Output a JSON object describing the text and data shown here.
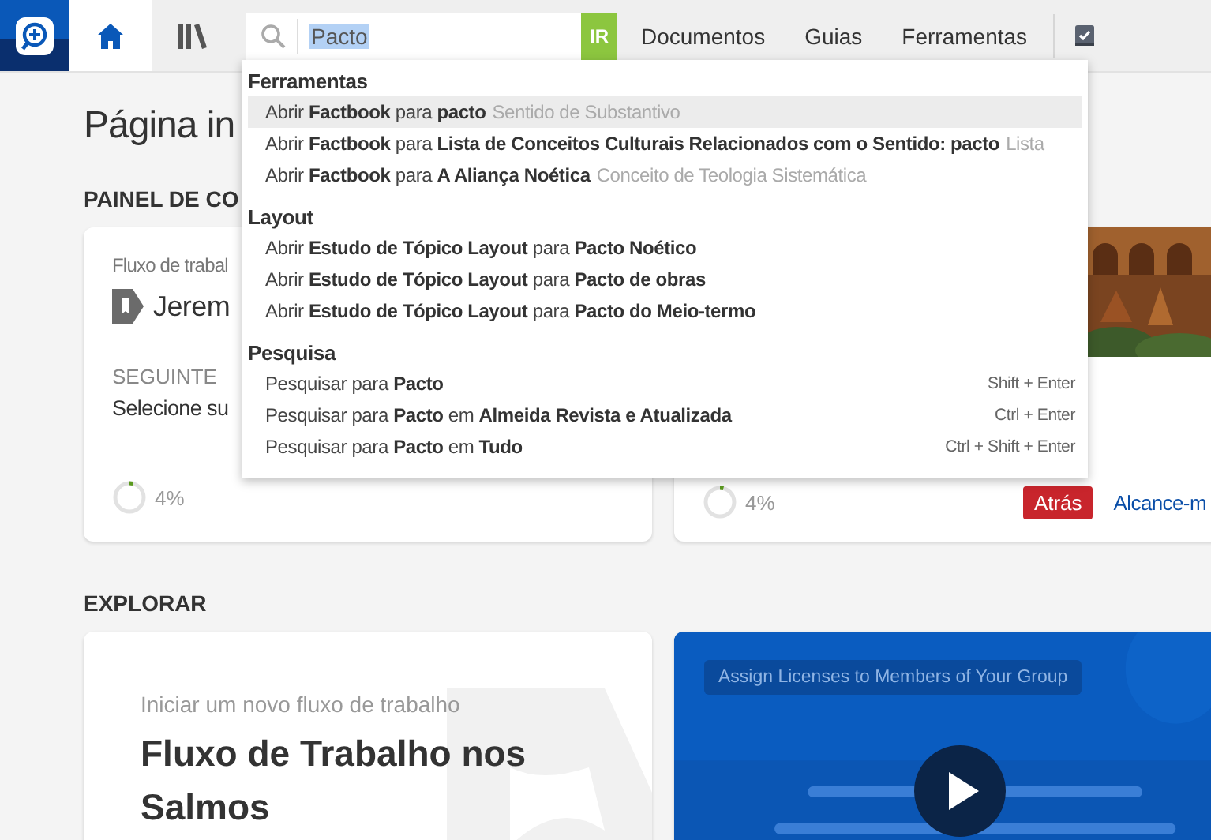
{
  "topbar": {
    "tabs": [
      {
        "kind": "home",
        "selected": true
      },
      {
        "kind": "library",
        "selected": false
      }
    ],
    "search": {
      "value": "Pacto",
      "button": "IR"
    },
    "menu": [
      "Documentos",
      "Guias",
      "Ferramentas"
    ]
  },
  "page": {
    "title": "Página in",
    "section": "PAINEL DE CO"
  },
  "cards": [
    {
      "label": "Fluxo de trabal",
      "title": "Jerem",
      "next_label": "SEGUINTE",
      "next": "Selecione su",
      "progress": {
        "level": 0.04,
        "reading": "4%"
      }
    },
    {
      "progress": {
        "level": 0.04,
        "reading": "4%"
      },
      "back_button": "Atrás",
      "link": "Alcance-m"
    }
  ],
  "explore": {
    "title": "EXPLORAR",
    "card": {
      "subtitle": "Iniciar um novo fluxo de trabalho",
      "title": "Fluxo de Trabalho nos Salmos"
    },
    "video": {
      "tag": "Assign Licenses to Members of Your Group"
    }
  },
  "dropdown": {
    "groups": [
      {
        "title": "Ferramentas",
        "items": [
          {
            "text": "Abrir **Factbook** para **pacto**",
            "hint": "Sentido de Substantivo",
            "selected": true
          },
          {
            "text": "Abrir **Factbook** para **Lista de Conceitos Culturais Relacionados com o Sentido: pacto**",
            "hint": "Lista",
            "selected": false
          },
          {
            "text": "Abrir **Factbook** para **A Aliança Noética**",
            "hint": "Conceito de Teologia Sistemática",
            "selected": false
          }
        ]
      },
      {
        "title": "Layout",
        "items": [
          {
            "text": "Abrir **Estudo de Tópico Layout** para **Pacto Noético**",
            "selected": false
          },
          {
            "text": "Abrir **Estudo de Tópico Layout** para **Pacto de obras**",
            "selected": false
          },
          {
            "text": "Abrir **Estudo de Tópico Layout** para **Pacto do Meio-termo**",
            "selected": false
          }
        ]
      },
      {
        "title": "Pesquisa",
        "items": [
          {
            "text": "Pesquisar para **Pacto**",
            "shortcut": "Shift + Enter",
            "selected": false
          },
          {
            "text": "Pesquisar para **Pacto** em **Almeida Revista e Atualizada**",
            "shortcut": "Ctrl + Enter",
            "selected": false
          },
          {
            "text": "Pesquisar para **Pacto** em **Tudo**",
            "shortcut": "Ctrl + Shift + Enter",
            "selected": false
          }
        ]
      }
    ]
  }
}
